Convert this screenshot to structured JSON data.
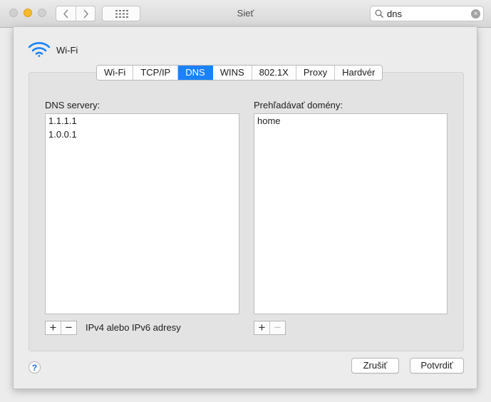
{
  "window": {
    "title": "Sieť"
  },
  "toolbar": {
    "back_icon": "chevron-left-icon",
    "forward_icon": "chevron-right-icon",
    "grid_icon": "show-all-grid-icon",
    "search": {
      "value": "dns",
      "placeholder": ""
    }
  },
  "interface": {
    "name": "Wi-Fi",
    "icon": "wifi-icon"
  },
  "tabs": [
    {
      "label": "Wi-Fi",
      "active": false
    },
    {
      "label": "TCP/IP",
      "active": false
    },
    {
      "label": "DNS",
      "active": true
    },
    {
      "label": "WINS",
      "active": false
    },
    {
      "label": "802.1X",
      "active": false
    },
    {
      "label": "Proxy",
      "active": false
    },
    {
      "label": "Hardvér",
      "active": false
    }
  ],
  "dns_servers": {
    "label": "DNS servery:",
    "items": [
      "1.1.1.1",
      "1.0.0.1"
    ],
    "hint": "IPv4 alebo IPv6 adresy"
  },
  "search_domains": {
    "label": "Prehľadávať domény:",
    "items": [
      "home"
    ]
  },
  "buttons": {
    "help": "?",
    "cancel": "Zrušiť",
    "ok": "Potvrdiť",
    "add": "+",
    "remove": "−"
  },
  "colors": {
    "accent": "#1a82fb",
    "minimize": "#f5bb2d"
  }
}
